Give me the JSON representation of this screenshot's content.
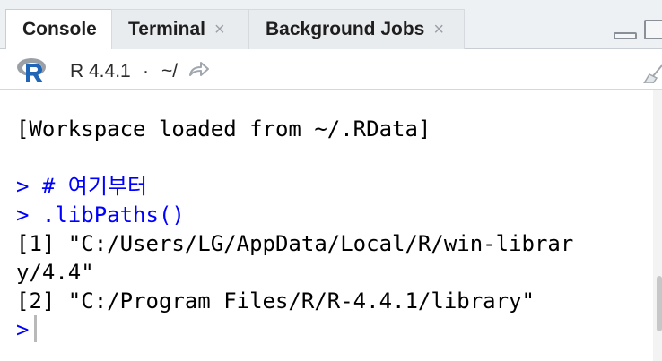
{
  "tabs": [
    {
      "label": "Console",
      "active": true
    },
    {
      "label": "Terminal",
      "close": "×"
    },
    {
      "label": "Background Jobs",
      "close": "×"
    }
  ],
  "toolbar": {
    "r_version": "R 4.4.1",
    "separator": "·",
    "working_dir": "~/"
  },
  "console": {
    "lines": [
      {
        "type": "output",
        "text": "[Workspace loaded from ~/.RData]"
      },
      {
        "type": "blank",
        "text": ""
      },
      {
        "type": "input",
        "text": "> # 여기부터"
      },
      {
        "type": "input",
        "text": "> .libPaths()"
      },
      {
        "type": "output",
        "text": "[1] \"C:/Users/LG/AppData/Local/R/win-librar"
      },
      {
        "type": "output",
        "text": "y/4.4\""
      },
      {
        "type": "output",
        "text": "[2] \"C:/Program Files/R/R-4.4.1/library\""
      },
      {
        "type": "prompt",
        "text": ">"
      }
    ]
  },
  "colors": {
    "input_text": "#0000ff",
    "output_text": "#000000",
    "tabbar_bg": "#eef1f4",
    "r_logo_blue": "#2165b6",
    "r_logo_gray": "#9aa0a6"
  },
  "icons": {
    "r_logo": "r-logo-icon",
    "goto_dir": "arrow-right-icon",
    "clear_console": "broom-icon",
    "minimize": "minimize-icon",
    "maximize": "maximize-icon",
    "close_tab": "close-icon"
  }
}
